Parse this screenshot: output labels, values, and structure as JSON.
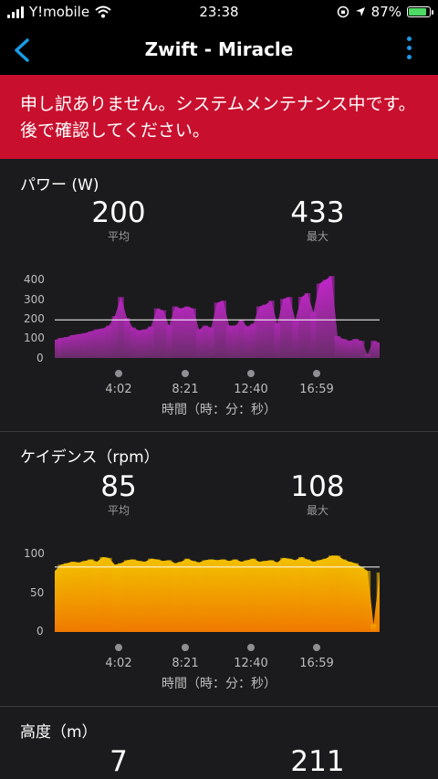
{
  "status_bar": {
    "carrier": "Y!mobile",
    "time": "23:38",
    "battery_pct": "87%"
  },
  "nav": {
    "title": "Zwift - Miracle"
  },
  "banner": {
    "message": "申し訳ありません。システムメンテナンス中です。後で確認してください。"
  },
  "time_axis_title": "時間（時：分：秒）",
  "power": {
    "title": "パワー (W)",
    "avg_value": "200",
    "avg_label": "平均",
    "max_value": "433",
    "max_label": "最大",
    "y_ticks": [
      "400",
      "300",
      "200",
      "100",
      "0"
    ],
    "x_ticks": [
      "4:02",
      "8:21",
      "12:40",
      "16:59"
    ]
  },
  "cadence": {
    "title": "ケイデンス（rpm）",
    "avg_value": "85",
    "avg_label": "平均",
    "max_value": "108",
    "max_label": "最大",
    "y_ticks": [
      "100",
      "50",
      "0"
    ],
    "x_ticks": [
      "4:02",
      "8:21",
      "12:40",
      "16:59"
    ]
  },
  "elevation": {
    "title": "高度（m）",
    "value_left": "7",
    "value_right": "211"
  },
  "chart_data": [
    {
      "type": "area",
      "ylim": [
        0,
        450
      ],
      "avg_line": 200,
      "color": "#a0239b",
      "x_ticks": [
        "4:02",
        "8:21",
        "12:40",
        "16:59"
      ],
      "values": [
        95,
        105,
        110,
        120,
        125,
        130,
        140,
        150,
        155,
        170,
        220,
        320,
        210,
        160,
        145,
        150,
        165,
        260,
        250,
        170,
        270,
        260,
        270,
        260,
        150,
        170,
        160,
        290,
        300,
        170,
        170,
        200,
        165,
        180,
        270,
        280,
        300,
        180,
        310,
        320,
        200,
        320,
        340,
        240,
        390,
        410,
        430,
        115,
        100,
        90,
        100,
        90,
        20,
        90,
        80
      ]
    },
    {
      "type": "area",
      "ylim": [
        0,
        110
      ],
      "avg_line": 85,
      "color": "#f0a020",
      "x_ticks": [
        "4:02",
        "8:21",
        "12:40",
        "16:59"
      ],
      "values": [
        80,
        88,
        90,
        92,
        91,
        93,
        95,
        92,
        98,
        97,
        88,
        90,
        94,
        95,
        93,
        92,
        96,
        95,
        93,
        94,
        90,
        92,
        96,
        93,
        91,
        94,
        95,
        94,
        95,
        93,
        95,
        92,
        94,
        96,
        92,
        93,
        94,
        91,
        97,
        96,
        94,
        98,
        95,
        92,
        94,
        96,
        100,
        100,
        95,
        92,
        90,
        85,
        80,
        10,
        78
      ]
    }
  ]
}
